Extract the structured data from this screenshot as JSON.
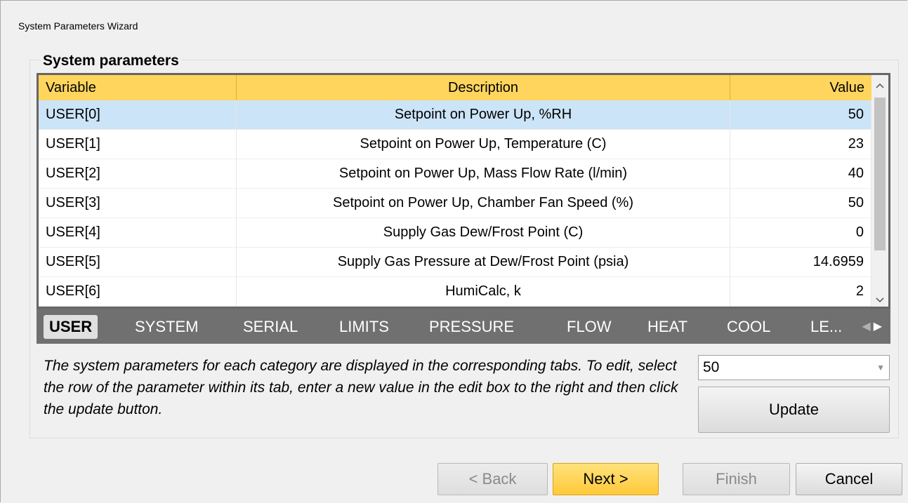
{
  "window": {
    "title": "System Parameters Wizard"
  },
  "group": {
    "title": "System parameters"
  },
  "grid": {
    "columns": {
      "variable": "Variable",
      "description": "Description",
      "value": "Value"
    },
    "rows": [
      {
        "variable": "USER[0]",
        "description": "Setpoint on Power Up, %RH",
        "value": "50",
        "selected": true
      },
      {
        "variable": "USER[1]",
        "description": "Setpoint on Power Up, Temperature (C)",
        "value": "23"
      },
      {
        "variable": "USER[2]",
        "description": "Setpoint on Power Up, Mass Flow Rate (l/min)",
        "value": "40"
      },
      {
        "variable": "USER[3]",
        "description": "Setpoint on Power Up, Chamber Fan Speed (%)",
        "value": "50"
      },
      {
        "variable": "USER[4]",
        "description": "Supply Gas Dew/Frost Point (C)",
        "value": "0"
      },
      {
        "variable": "USER[5]",
        "description": "Supply Gas Pressure at Dew/Frost Point (psia)",
        "value": "14.6959"
      },
      {
        "variable": "USER[6]",
        "description": "HumiCalc, k",
        "value": "2"
      }
    ],
    "scroll_up_icon": "chevron-up-icon",
    "scroll_down_icon": "chevron-down-icon"
  },
  "tabs": {
    "items": [
      "USER",
      "SYSTEM",
      "SERIAL",
      "LIMITS",
      "PRESSURE",
      "FLOW",
      "HEAT",
      "COOL",
      "LE..."
    ],
    "active": "USER",
    "scroll_left_icon": "triangle-left-icon",
    "scroll_right_icon": "triangle-right-icon"
  },
  "instructions": "The system parameters for each category are displayed in the corresponding tabs. To edit, select the row of the parameter within its tab, enter a new value in the edit box to the right and then click the update button.",
  "editor": {
    "value": "50",
    "update_label": "Update"
  },
  "nav": {
    "back": "< Back",
    "next": "Next >",
    "finish": "Finish",
    "cancel": "Cancel"
  },
  "colors": {
    "header": "#ffd55e",
    "selected_row": "#cce4f7",
    "tab_strip": "#707070",
    "primary_button": "#ffc93a"
  }
}
